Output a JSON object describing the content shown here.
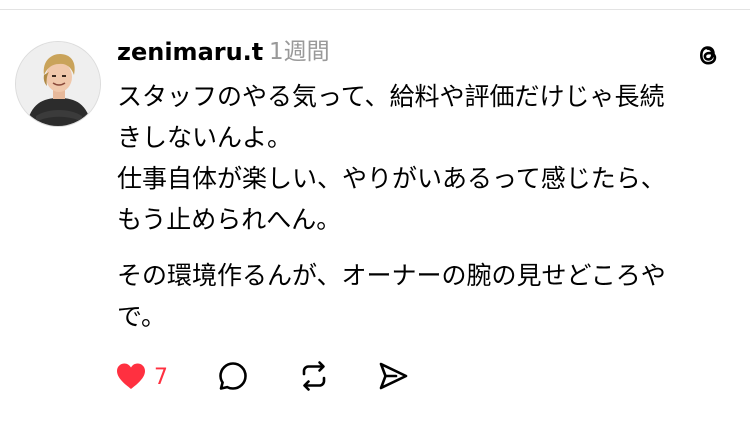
{
  "post": {
    "username": "zenimaru.t",
    "time": "1週間",
    "body_lines": [
      "スタッフのやる気って、給料や評価だけじゃ長続",
      "きしないんよ。",
      "仕事自体が楽しい、やりがいあるって感じたら、",
      "もう止められへん。",
      "その環境作るんが、オーナーの腕の見せどころや",
      "で。"
    ]
  },
  "actions": {
    "like_count": "7"
  },
  "icons": {
    "avatar": "profile-photo",
    "logo": "threads-logo-icon",
    "like": "heart-icon",
    "reply": "comment-icon",
    "repost": "repost-icon",
    "share": "send-icon"
  },
  "colors": {
    "like_active": "#ff3040",
    "text": "#000000",
    "secondary_text": "#999999"
  }
}
